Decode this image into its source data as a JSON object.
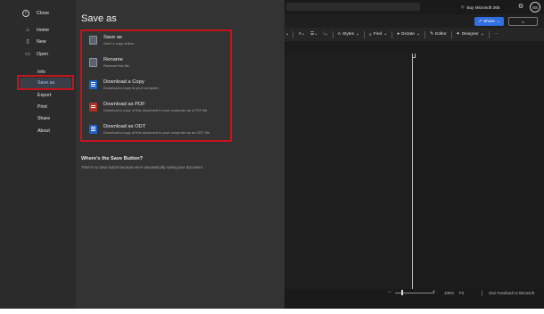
{
  "nav": {
    "close": "Close",
    "home": "Home",
    "new": "New",
    "open": "Open",
    "info": "Info",
    "save_as": "Save as",
    "export": "Export",
    "print": "Print",
    "share": "Share",
    "about": "About"
  },
  "backstage": {
    "title": "Save as",
    "options": [
      {
        "title": "Save as",
        "desc": "Save a copy online.",
        "icon": "save-copy-icon"
      },
      {
        "title": "Rename",
        "desc": "Rename this file.",
        "icon": "rename-icon"
      },
      {
        "title": "Download a Copy",
        "desc": "Download a copy to your computer.",
        "icon": "download-doc-icon"
      },
      {
        "title": "Download as PDF",
        "desc": "Download a copy of this document to your computer as a PDF file.",
        "icon": "pdf-icon"
      },
      {
        "title": "Download as ODT",
        "desc": "Download a copy of this document to your computer as an ODT file.",
        "icon": "odt-icon"
      }
    ],
    "where_title": "Where's the Save Button?",
    "where_text": "There's no Save button because we're automatically saving your document."
  },
  "topbar": {
    "buy": "Buy Microsoft 365",
    "avatar": "SS"
  },
  "share_label": "Share",
  "ribbon": {
    "styles": "Styles",
    "find": "Find",
    "dictate": "Dictate",
    "editor": "Editor",
    "designer": "Designer",
    "more": "···"
  },
  "status": {
    "zoom_level": "100%",
    "fit": "Fit",
    "feedback": "Give Feedback to Microsoft",
    "zoom_fraction": 0.18
  },
  "colors": {
    "accent": "#2f6fe0",
    "highlight": "#c4141c",
    "active_text": "#9ec5ff"
  }
}
